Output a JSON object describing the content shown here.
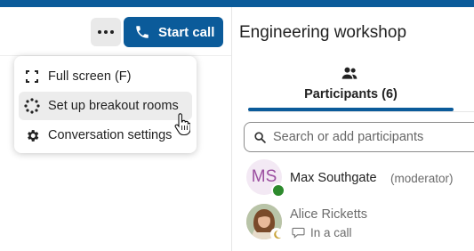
{
  "colors": {
    "brand": "#0b5b9a",
    "moderator_avatar_text": "#9b4fa0",
    "moderator_avatar_bg": "#f3e9f4",
    "online_status": "#2d8a2d"
  },
  "header": {
    "more_icon": "more-horizontal-icon",
    "start_call_label": "Start call",
    "start_call_icon": "phone-icon"
  },
  "menu": {
    "items": [
      {
        "label": "Full screen (F)",
        "icon": "fullscreen-icon"
      },
      {
        "label": "Set up breakout rooms",
        "icon": "breakout-rooms-icon",
        "hovered": true
      },
      {
        "label": "Conversation settings",
        "icon": "gear-icon"
      }
    ]
  },
  "sidebar": {
    "title": "Engineering workshop",
    "tabs": [
      {
        "label": "Participants (6)",
        "icon": "participants-icon",
        "active": true
      }
    ],
    "search": {
      "placeholder": "Search or add participants",
      "value": "",
      "icon": "search-icon"
    },
    "participants": [
      {
        "initials": "MS",
        "name": "Max Southgate",
        "role": "(moderator)",
        "status": "online"
      },
      {
        "name": "Alice Ricketts",
        "status_text": "In a call",
        "status_icon": "chat-bubble-icon",
        "status": "away"
      }
    ]
  }
}
